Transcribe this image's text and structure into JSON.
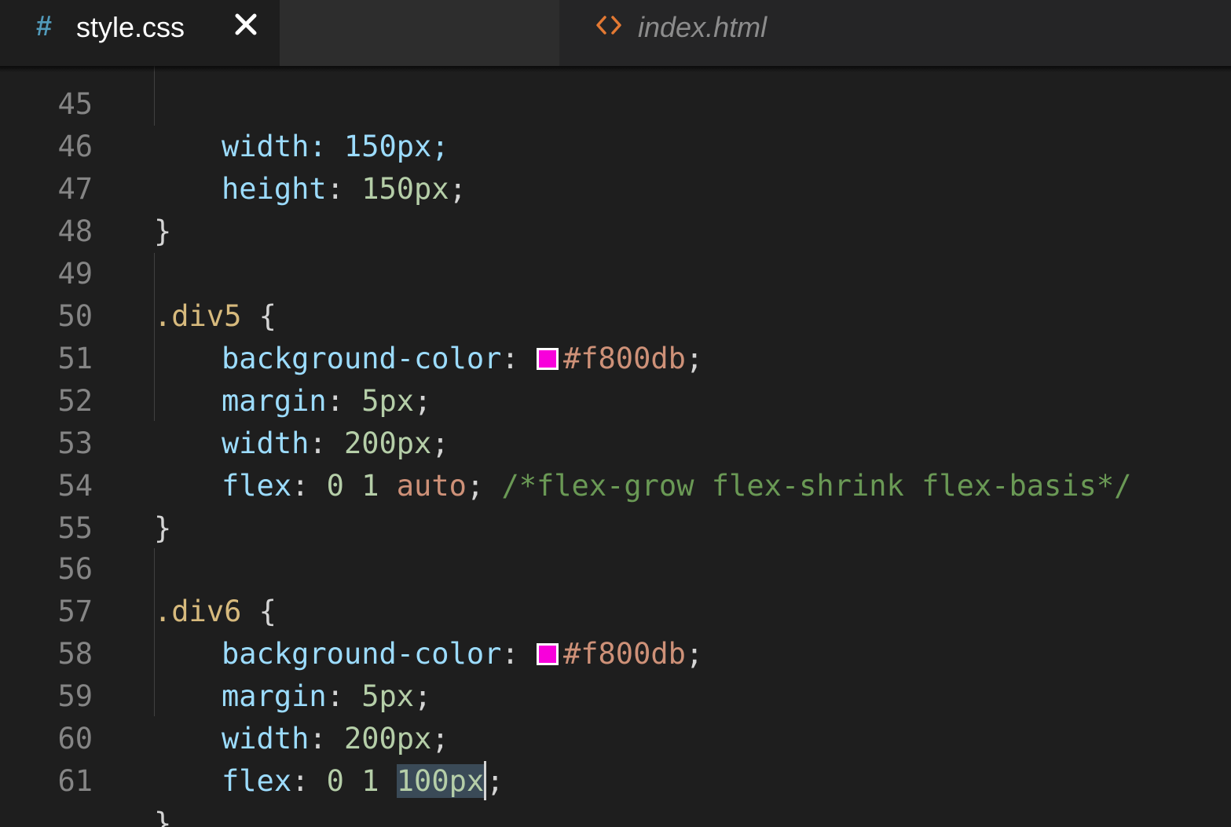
{
  "tabs": [
    {
      "label": "style.css",
      "icon": "hash-icon",
      "active": true,
      "close_symbol": "×"
    },
    {
      "label": "index.html",
      "icon": "code-icon",
      "active": false
    }
  ],
  "colors": {
    "background": "#1e1e1e",
    "tabbar": "#252526",
    "property": "#9cdcfe",
    "number": "#b5cea8",
    "selector": "#d7ba7d",
    "value_keyword": "#ce9178",
    "comment": "#6a9955",
    "swatch": "#f800db"
  },
  "code": {
    "partial_line": {
      "number": "45",
      "text": "width: 150px;"
    },
    "lines": [
      {
        "number": "46",
        "prop": "height",
        "value": "150px"
      },
      {
        "number": "47",
        "text": "}"
      },
      {
        "number": "48",
        "text": ""
      },
      {
        "number": "49",
        "selector": ".div5",
        "brace": "{"
      },
      {
        "number": "50",
        "prop": "background-color",
        "color_value": "#f800db"
      },
      {
        "number": "51",
        "prop": "margin",
        "value": "5px"
      },
      {
        "number": "52",
        "prop": "width",
        "value": "200px"
      },
      {
        "number": "53",
        "prop": "flex",
        "value_a": "0 1",
        "value_b": "auto",
        "comment": "/*flex-grow flex-shrink flex-basis*/"
      },
      {
        "number": "54",
        "text": "}"
      },
      {
        "number": "55",
        "text": ""
      },
      {
        "number": "56",
        "selector": ".div6",
        "brace": "{"
      },
      {
        "number": "57",
        "prop": "background-color",
        "color_value": "#f800db"
      },
      {
        "number": "58",
        "prop": "margin",
        "value": "5px"
      },
      {
        "number": "59",
        "prop": "width",
        "value": "200px"
      },
      {
        "number": "60",
        "prop": "flex",
        "value_a": "0 1",
        "value_b": "100px"
      },
      {
        "number": "61",
        "text": "}"
      }
    ]
  }
}
